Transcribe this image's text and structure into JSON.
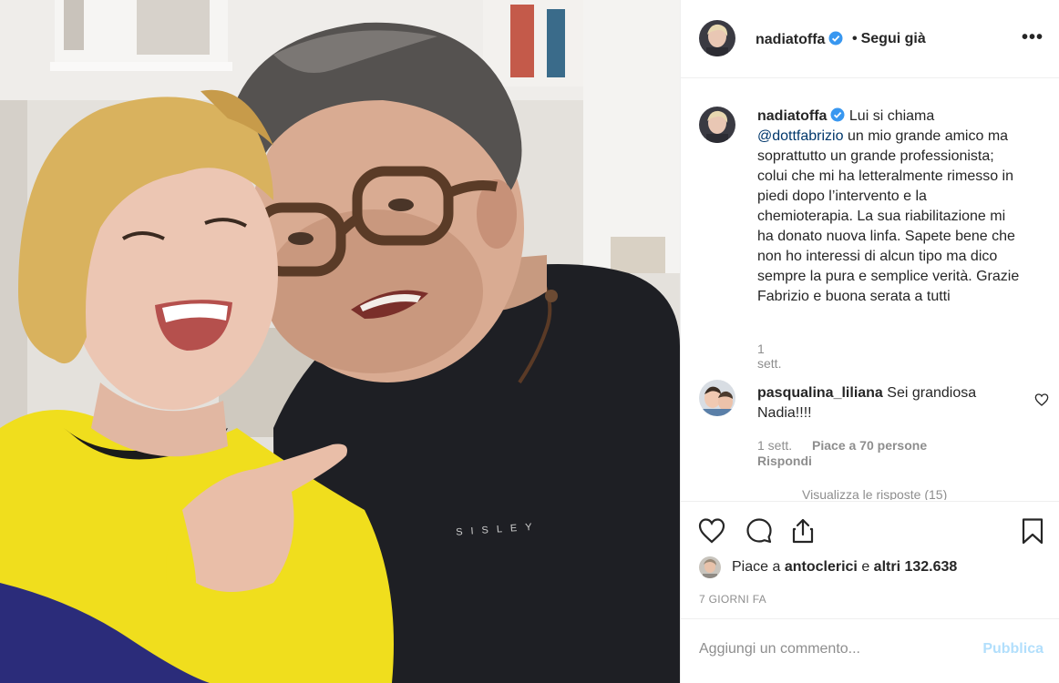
{
  "header": {
    "username": "nadiatoffa",
    "follow_status": "Segui già",
    "more": "•••"
  },
  "caption": {
    "username": "nadiatoffa",
    "text_before": "Lui si chiama",
    "mention": "@dottfabrizio",
    "text_after": "un mio grande amico ma soprattutto un grande professionista; colui che mi ha letteralmente rimesso in piedi dopo l’intervento e la chemioterapia. La sua riabilitazione mi ha donato nuova linfa. Sapete bene che non ho interessi di alcun tipo ma dico sempre la pura e semplice verità. Grazie Fabrizio e buona serata a tutti",
    "time": "1 sett."
  },
  "comments": [
    {
      "username": "pasqualina_liliana",
      "text": "Sei grandiosa Nadia!!!!",
      "time": "1 sett.",
      "likes": "Piace a 70 persone",
      "reply": "Rispondi"
    }
  ],
  "view_replies": "Visualizza le risposte (15)",
  "actions": {
    "likes_prefix": "Piace a",
    "likes_user": "antoclerici",
    "likes_mid": "e",
    "likes_others": "altri 132.638",
    "date": "7 GIORNI FA"
  },
  "add_comment": {
    "placeholder": "Aggiungi un commento...",
    "publish": "Pubblica"
  },
  "colors": {
    "verified_blue": "#3897f0",
    "link_blue": "#00376b",
    "muted": "#8e8e8e",
    "publish_disabled": "#b2dffc"
  },
  "photo": {
    "shirt_text": "SISLEY"
  }
}
